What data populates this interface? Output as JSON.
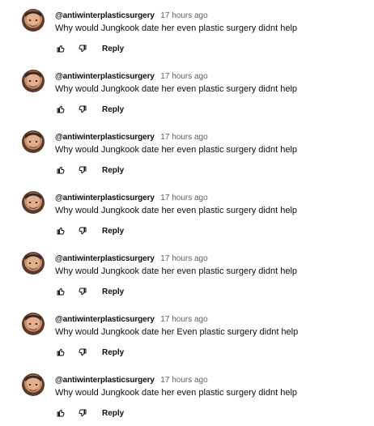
{
  "comments": [
    {
      "author": "@antiwinterplasticsurgery",
      "time": "17 hours ago",
      "text": "Why would Jungkook date her even plastic surgery didnt help",
      "reply_label": "Reply"
    },
    {
      "author": "@antiwinterplasticsurgery",
      "time": "17 hours ago",
      "text": "Why would Jungkook date her even plastic surgery didnt help",
      "reply_label": "Reply"
    },
    {
      "author": "@antiwinterplasticsurgery",
      "time": "17 hours ago",
      "text": "Why would Jungkook date her even plastic surgery didnt help",
      "reply_label": "Reply"
    },
    {
      "author": "@antiwinterplasticsurgery",
      "time": "17 hours ago",
      "text": "Why would Jungkook date her even plastic surgery didnt help",
      "reply_label": "Reply"
    },
    {
      "author": "@antiwinterplasticsurgery",
      "time": "17 hours ago",
      "text": "Why would Jungkook date her even plastic surgery didnt help",
      "reply_label": "Reply"
    },
    {
      "author": "@antiwinterplasticsurgery",
      "time": "17 hours ago",
      "text": "Why would Jungkook date her Even plastic surgery didnt help",
      "reply_label": "Reply"
    },
    {
      "author": "@antiwinterplasticsurgery",
      "time": "17 hours ago",
      "text": "Why would Jungkook date her even plastic surgery didnt help",
      "reply_label": "Reply"
    }
  ],
  "icons": {
    "like": "thumbs-up-icon",
    "dislike": "thumbs-down-icon",
    "avatar": "avatar"
  },
  "colors": {
    "text": "#0f0f0f",
    "secondary_text": "#606060",
    "background": "#ffffff"
  }
}
